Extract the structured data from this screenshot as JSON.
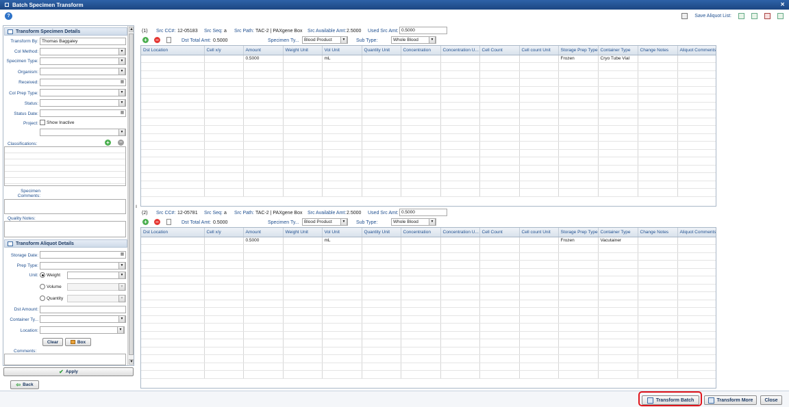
{
  "window": {
    "title": "Batch Specimen Transform"
  },
  "toolbar": {
    "save_aliquot_label": "Save Aliquot List:"
  },
  "left_panel": {
    "specimen_section_title": "Transform Specimen Details",
    "transform_by": {
      "label": "Transform By:",
      "value": "Thomas Baggaley"
    },
    "col_method": {
      "label": "Col Method:",
      "value": ""
    },
    "specimen_type": {
      "label": "Specimen Type:",
      "value": ""
    },
    "organism": {
      "label": "Organism:",
      "value": ""
    },
    "received": {
      "label": "Received:",
      "value": ""
    },
    "col_prep_type": {
      "label": "Col Prep Type:",
      "value": ""
    },
    "status": {
      "label": "Status:",
      "value": ""
    },
    "status_date": {
      "label": "Status Date:",
      "value": ""
    },
    "project": {
      "label": "Project:",
      "show_inactive": "Show Inactive"
    },
    "classifications_label": "Classifications:",
    "specimen_comments_label": "Specimen Comments:",
    "quality_notes_label": "Quality Notes:",
    "aliquot_section_title": "Transform Aliquot Details",
    "storage_date": {
      "label": "Storage Date:",
      "value": ""
    },
    "prep_type": {
      "label": "Prep Type:",
      "value": ""
    },
    "unit": {
      "label": "Unit:",
      "options": [
        "Weight",
        "Volume",
        "Quantity"
      ],
      "selected": "Weight"
    },
    "dst_amount": {
      "label": "Dst Amount:",
      "value": ""
    },
    "container_type": {
      "label": "Container Ty...",
      "value": ""
    },
    "location": {
      "label": "Location:",
      "value": ""
    },
    "clear_label": "Clear",
    "box_label": "Box",
    "comments_label": "Comments:",
    "apply_label": "Apply",
    "back_label": "Back"
  },
  "batches": [
    {
      "index": "(1)",
      "src_cc_label": "Src CC#:",
      "src_cc": "12-05183",
      "src_seq_label": "Src Seq:",
      "src_seq": "a",
      "src_path_label": "Src Path:",
      "src_path": "TAC-2 | PAXgene Box",
      "src_avail_label": "Src Available Amt:",
      "src_avail": "2.5000",
      "used_src_label": "Used Src Amt:",
      "used_src": "0.5000",
      "dst_total_label": "Dst Total Amt:",
      "dst_total": "0.5000",
      "specimen_type_label": "Specimen Ty...",
      "specimen_type": "Blood Product",
      "sub_type_label": "Sub Type:",
      "sub_type": "Whole Blood",
      "rows": [
        [
          "",
          "",
          "0.5000",
          "",
          "mL",
          "",
          "",
          "",
          "",
          "",
          "Frozen",
          "Cryo Tube Vial",
          "",
          ""
        ]
      ]
    },
    {
      "index": "(2)",
      "src_cc_label": "Src CC#:",
      "src_cc": "12-05781",
      "src_seq_label": "Src Seq:",
      "src_seq": "a",
      "src_path_label": "Src Path:",
      "src_path": "TAC-2 | PAXgene Box",
      "src_avail_label": "Src Available Amt:",
      "src_avail": "2.5000",
      "used_src_label": "Used Src Amt:",
      "used_src": "0.5000",
      "dst_total_label": "Dst Total Amt:",
      "dst_total": "0.5000",
      "specimen_type_label": "Specimen Ty...",
      "specimen_type": "Blood Product",
      "sub_type_label": "Sub Type:",
      "sub_type": "Whole Blood",
      "rows": [
        [
          "",
          "",
          "0.5000",
          "",
          "mL",
          "",
          "",
          "",
          "",
          "",
          "Frozen",
          "Vacutainer",
          "",
          ""
        ]
      ]
    }
  ],
  "grid_columns": [
    "Dst Location",
    "Cell x/y",
    "Amount",
    "Weight Unit",
    "Vol Unit",
    "Quantity Unit",
    "Concentration",
    "Concentration U...",
    "Cell Count",
    "Cell count Unit",
    "Storage Prep Type",
    "Container Type",
    "Change Notes",
    "Aliquot Comments"
  ],
  "footer": {
    "transform_batch_label": "Transform Batch",
    "transform_more_label": "Transform More",
    "close_label": "Close"
  },
  "colors": {
    "title_bar": "#1c4682",
    "highlight": "#e0141b",
    "label_blue": "#1f4f8f"
  }
}
